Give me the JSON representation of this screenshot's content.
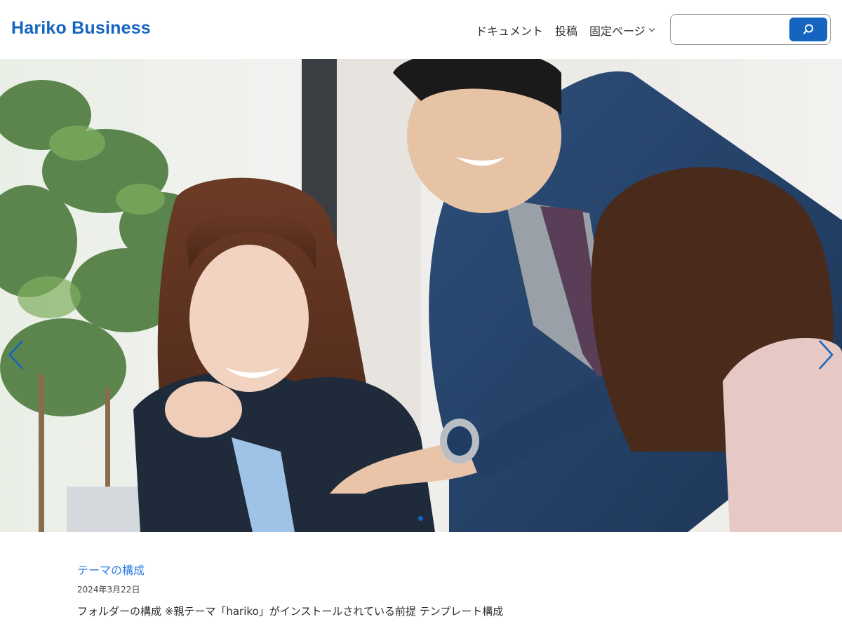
{
  "header": {
    "site_title": "Hariko Business",
    "nav": [
      {
        "label": "ドキュメント"
      },
      {
        "label": "投稿"
      },
      {
        "label": "固定ページ"
      }
    ],
    "search": {
      "value": "",
      "button_icon": "search-icon"
    }
  },
  "hero": {
    "image": "office-team-photo",
    "prev_icon": "chevron-left-icon",
    "next_icon": "chevron-right-icon",
    "slides_indicator": 1
  },
  "post": {
    "title": "テーマの構成",
    "date": "2024年3月22日",
    "excerpt": "フォルダーの構成 ※親テーマ「hariko」がインストールされている前提 テンプレート構成"
  },
  "colors": {
    "brand": "#1565c0",
    "link": "#2a7ae4",
    "text": "#2b2b2b"
  }
}
